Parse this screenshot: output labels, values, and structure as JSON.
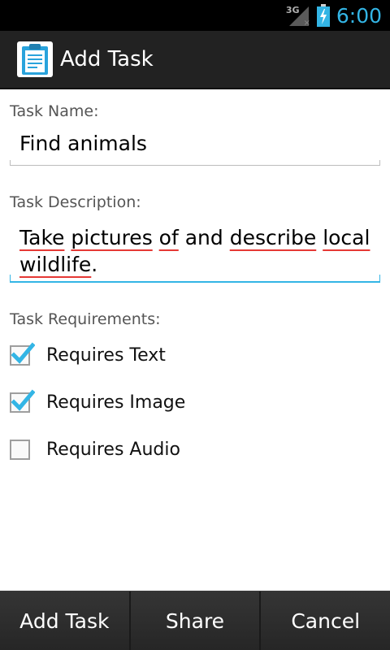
{
  "status_bar": {
    "network_type": "3G",
    "signal_icon": "signal-no-data-icon",
    "battery_icon": "battery-charging-icon",
    "time": "6:00",
    "accent_color": "#33b5e5"
  },
  "action_bar": {
    "icon": "clipboard-icon",
    "title": "Add Task"
  },
  "form": {
    "task_name": {
      "label": "Task Name:",
      "value": "Find animals"
    },
    "task_description": {
      "label": "Task Description:",
      "value_words": [
        "Take",
        "pictures",
        "of",
        "and",
        "describe",
        "local"
      ],
      "value_line2": "wildlife",
      "value_line2_suffix": "."
    },
    "requirements": {
      "label": "Task Requirements:",
      "items": [
        {
          "label": "Requires Text",
          "checked": true
        },
        {
          "label": "Requires Image",
          "checked": true
        },
        {
          "label": "Requires Audio",
          "checked": false
        }
      ]
    }
  },
  "bottom_bar": {
    "add_task": "Add Task",
    "share": "Share",
    "cancel": "Cancel"
  }
}
